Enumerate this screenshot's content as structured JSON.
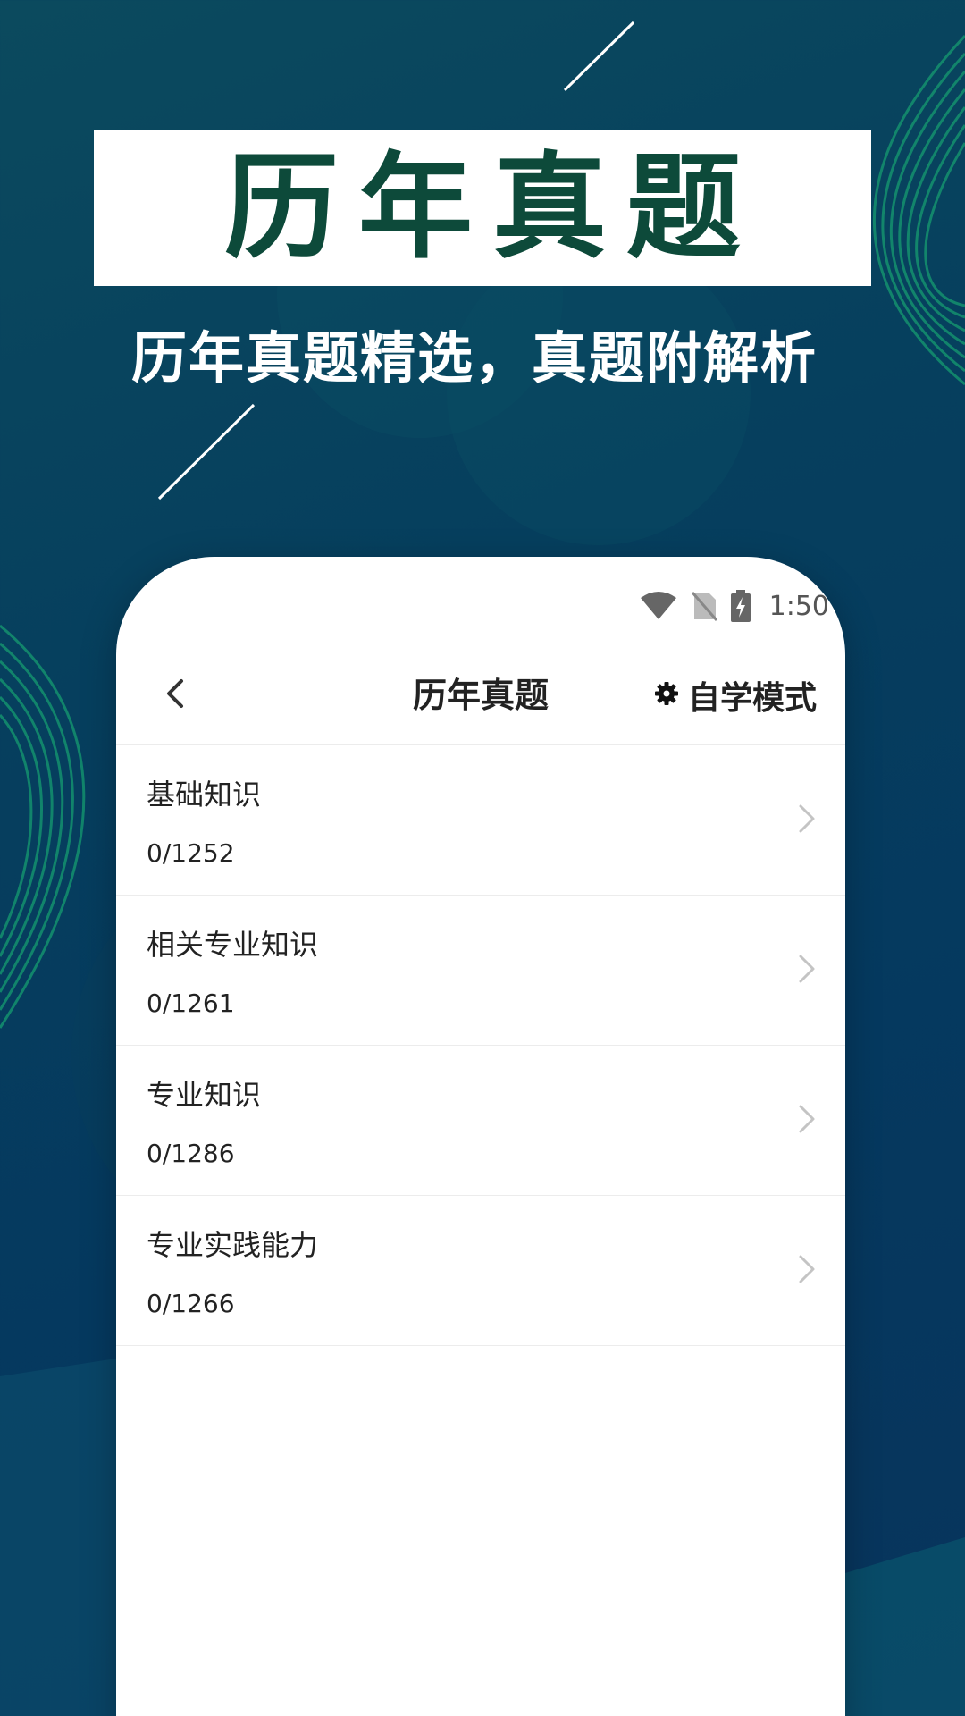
{
  "banner": {
    "title": "历年真题",
    "subtitle": "历年真题精选，真题附解析"
  },
  "status_bar": {
    "time": "1:50",
    "icons": [
      "wifi-icon",
      "no-sim-icon",
      "battery-charging-icon"
    ]
  },
  "nav": {
    "title": "历年真题",
    "back_icon": "chevron-left-icon",
    "mode_icon": "gear-icon",
    "mode_label": "自学模式"
  },
  "list": [
    {
      "title": "基础知识",
      "count": "0/1252"
    },
    {
      "title": "相关专业知识",
      "count": "0/1261"
    },
    {
      "title": "专业知识",
      "count": "0/1286"
    },
    {
      "title": "专业实践能力",
      "count": "0/1266"
    }
  ],
  "colors": {
    "background": "#063f5e",
    "banner_text": "#0d4a3a",
    "accent_green": "#0f8a6a"
  }
}
